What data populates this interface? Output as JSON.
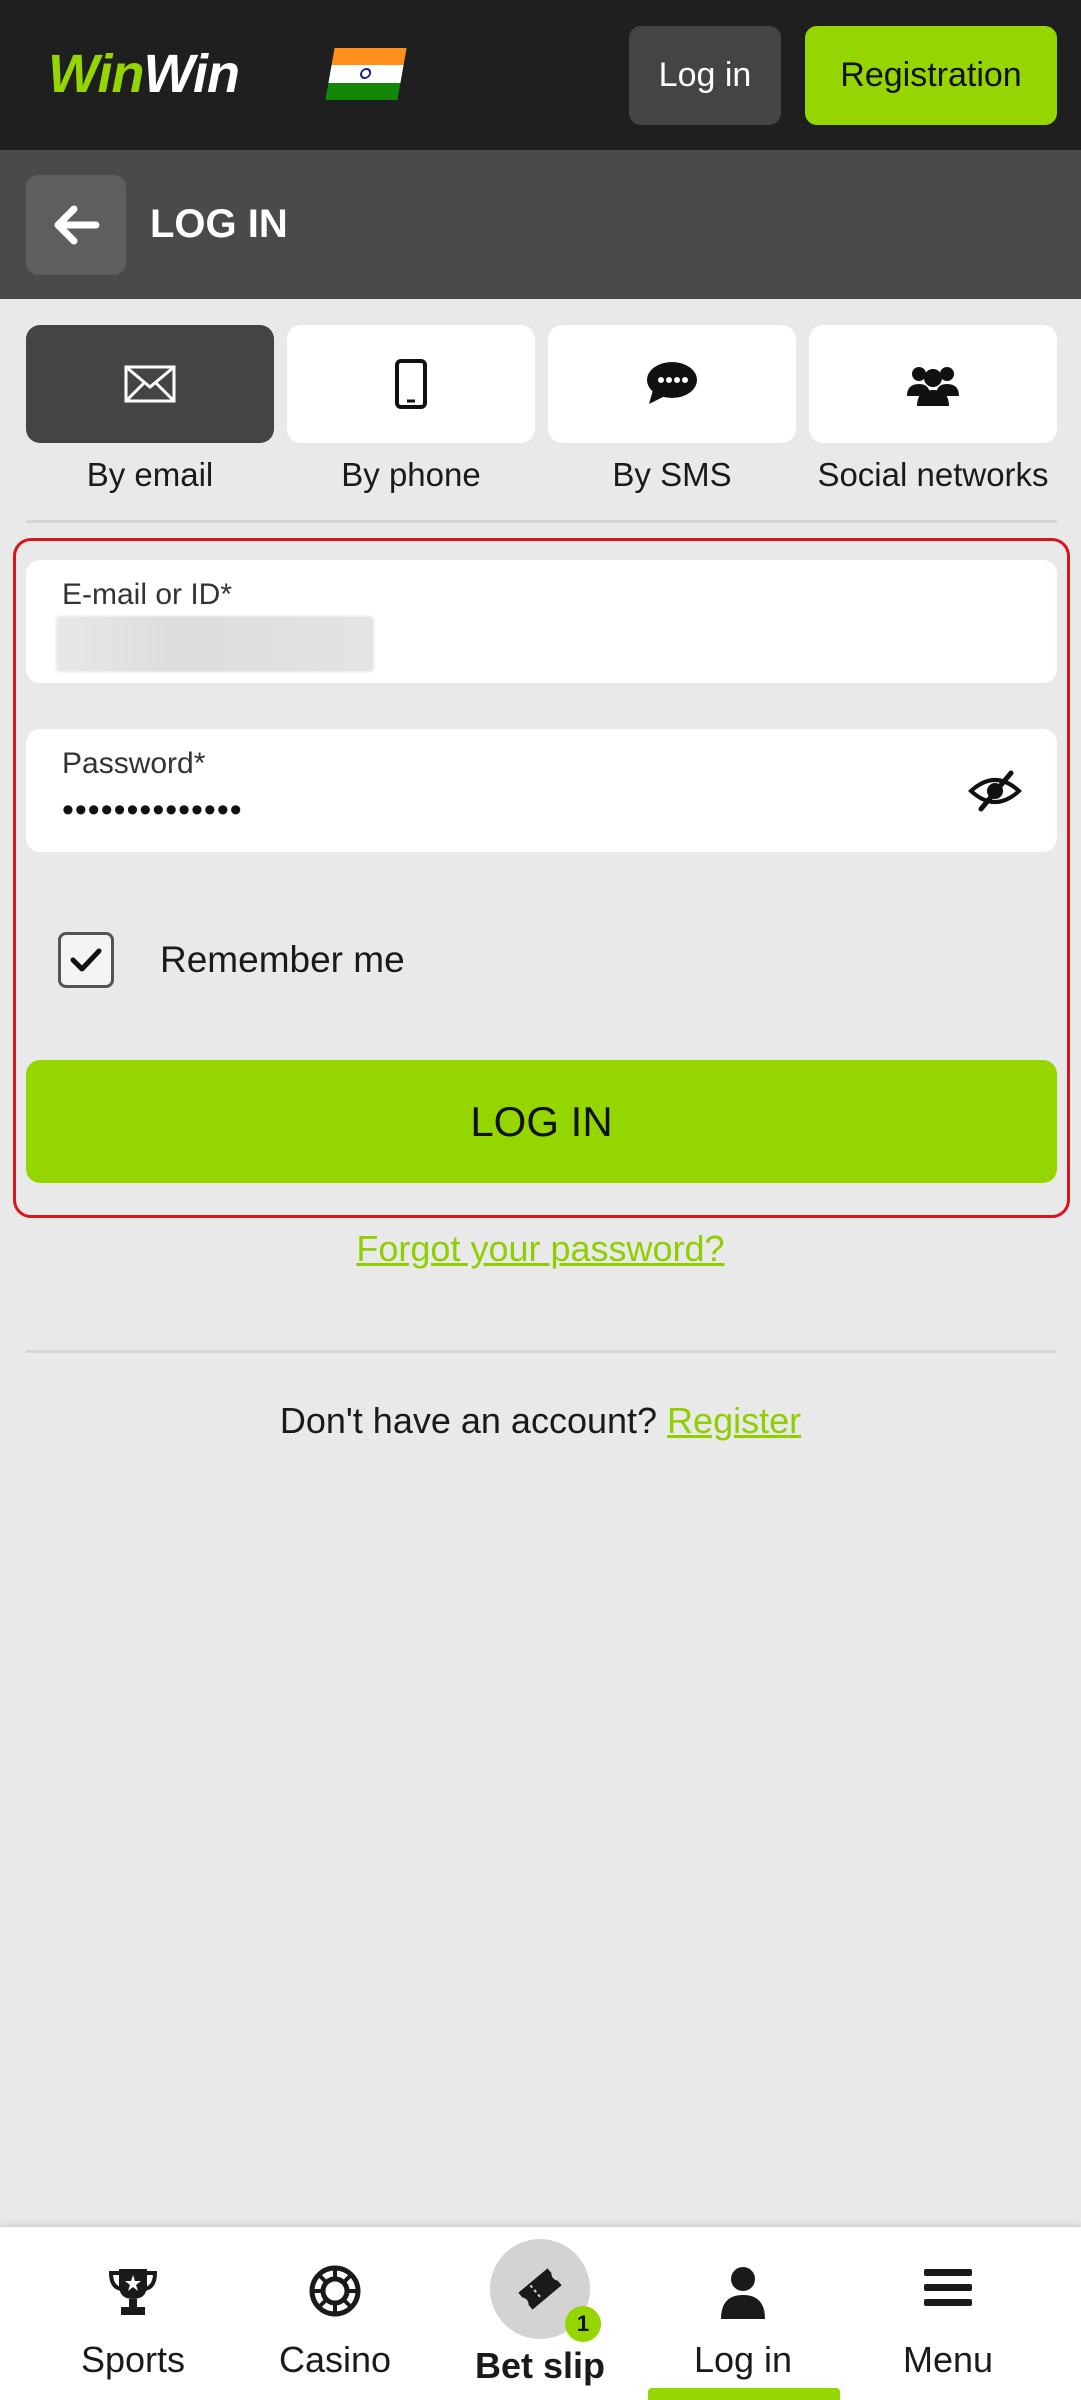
{
  "header": {
    "logo_part1": "Win",
    "logo_part2": "Win",
    "login_label": "Log in",
    "registration_label": "Registration"
  },
  "subheader": {
    "title": "LOG IN"
  },
  "tabs": [
    {
      "label": "By email",
      "icon": "envelope-icon",
      "active": true
    },
    {
      "label": "By phone",
      "icon": "phone-icon",
      "active": false
    },
    {
      "label": "By SMS",
      "icon": "sms-icon",
      "active": false
    },
    {
      "label": "Social networks",
      "icon": "users-icon",
      "active": false
    }
  ],
  "form": {
    "email_label": "E-mail or ID*",
    "email_value": "",
    "password_label": "Password*",
    "password_value": "••••••••••••••",
    "remember_label": "Remember me",
    "remember_checked": true,
    "submit_label": "LOG IN",
    "forgot_label": "Forgot your password?",
    "no_account_text": "Don't have an account?",
    "register_link": "Register"
  },
  "bottom_nav": [
    {
      "label": "Sports",
      "icon": "trophy-icon"
    },
    {
      "label": "Casino",
      "icon": "chip-icon"
    },
    {
      "label": "Bet slip",
      "icon": "ticket-icon",
      "badge": "1"
    },
    {
      "label": "Log in",
      "icon": "user-icon",
      "active": true
    },
    {
      "label": "Menu",
      "icon": "menu-icon"
    }
  ],
  "colors": {
    "accent": "#95d600",
    "header_bg": "#1f1f1f",
    "subheader_bg": "#4a4a4c",
    "highlight_border": "#d9141b"
  }
}
